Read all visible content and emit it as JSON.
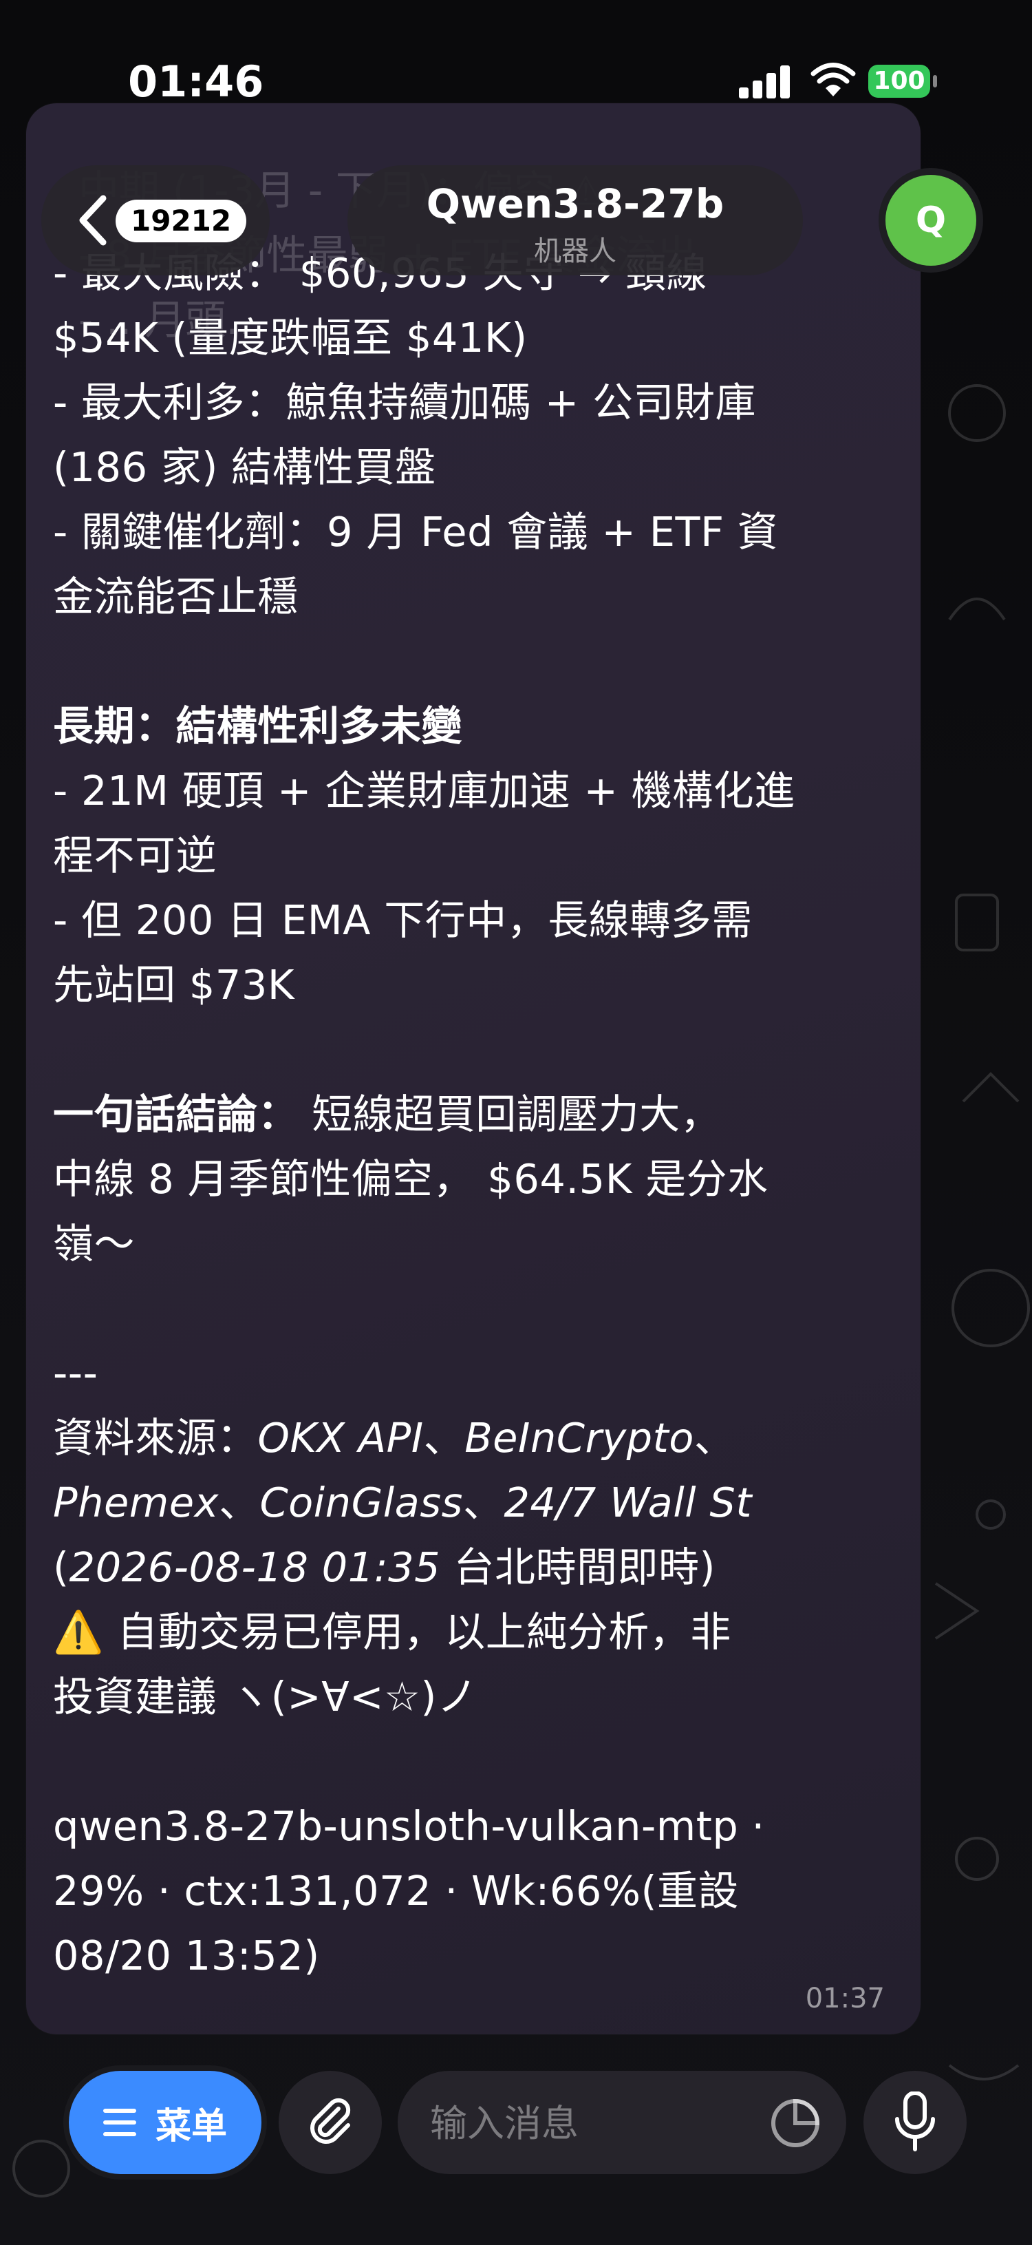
{
  "status_bar": {
    "time": "01:46",
    "battery": "100"
  },
  "header": {
    "back_count": "19212",
    "title": "Qwen3.8-27b",
    "subtitle": "机器人",
    "avatar_letter": "Q"
  },
  "faded_top": {
    "line1": "中期 (1-3月 - 下月)：偏空 ⚠",
    "line2": "- 8 月季節性最弱 + ETF 資金流出",
    "line3": "- ...月頭..."
  },
  "message": {
    "l1": "- 最大風險： $60,965 失守 → 頸線",
    "l2": "$54K (量度跌幅至 $41K)",
    "l3": "- 最大利多：鯨魚持續加碼 + 公司財庫",
    "l4": "(186 家) 結構性買盤",
    "l5": "- 關鍵催化劑：9 月 Fed 會議 + ETF 資",
    "l6": "金流能否止穩",
    "long_head": "長期：結構性利多未變",
    "l7": "- 21M 硬頂 + 企業財庫加速 + 機構化進",
    "l8": "程不可逆",
    "l9": "- 但 200 日 EMA 下行中，長線轉多需",
    "l10": "先站回 $73K",
    "concl_head": "一句話結論：",
    "concl_a": " 短線超買回調壓力大，",
    "concl_b": "中線 8 月季節性偏空， $64.5K 是分水",
    "concl_c": "嶺～",
    "divider": "---",
    "src_label": "資料來源：",
    "src_a": "OKX API",
    "sep1": "、",
    "src_b": "BeInCrypto",
    "sep2": "、",
    "src_c": "Phemex",
    "sep3": "、",
    "src_d": "CoinGlass",
    "sep4": "、",
    "src_e": "24/7 Wall St",
    "paren_open": "(",
    "src_time": "2026-08-18 01:35",
    "src_tz": " 台北時間即時)",
    "warn_icon": "⚠️",
    "warn_a": " 自動交易已停用，以上純分析，非",
    "warn_b": "投資建議 ヽ(>∀<☆)ノ",
    "foot_a": "qwen3.8-27b-unsloth-vulkan-mtp ·",
    "foot_b": "29% · ctx:131,072 · Wk:66%(重設",
    "foot_c": "08/20 13:52)",
    "time": "01:37"
  },
  "input_bar": {
    "menu_label": "菜单",
    "placeholder": "输入消息"
  },
  "icons": [
    "chevron-left-icon",
    "menu-lines-icon",
    "paperclip-icon",
    "sticker-icon",
    "microphone-icon",
    "signal-icon",
    "wifi-icon"
  ],
  "colors": {
    "accent": "#3b8bff",
    "avatar": "#5fc24a",
    "battery": "#34c759",
    "bubble": "#2a2436"
  }
}
